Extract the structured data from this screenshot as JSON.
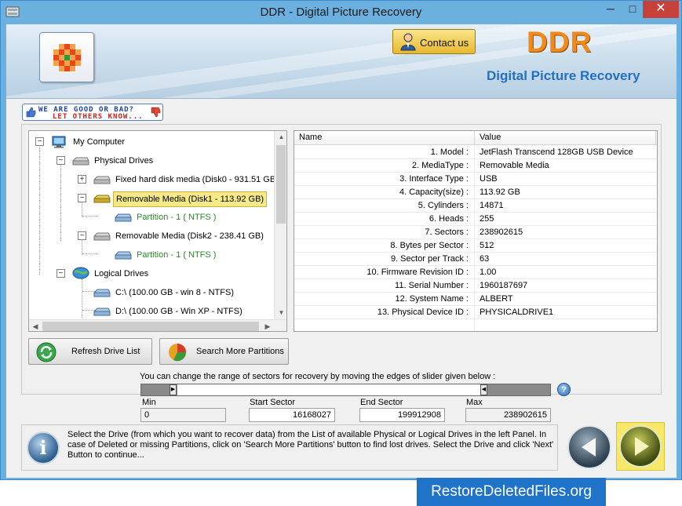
{
  "window": {
    "title": "DDR - Digital Picture Recovery",
    "controls": {
      "minimize": "─",
      "maximize": "□",
      "close": "✕"
    }
  },
  "header": {
    "contact_label": "Contact us",
    "brand": "DDR",
    "subtitle": "Digital Picture Recovery"
  },
  "feedback": {
    "line1": "WE ARE GOOD OR BAD?",
    "line2": "LET OTHERS KNOW..."
  },
  "tree": {
    "root": "My Computer",
    "physical_drives": "Physical Drives",
    "disk0": "Fixed hard disk media (Disk0 - 931.51 GB)",
    "disk1": "Removable Media (Disk1 - 113.92 GB)",
    "disk1_partition": "Partition - 1 ( NTFS )",
    "disk2": "Removable Media (Disk2 - 238.41 GB)",
    "disk2_partition": "Partition - 1 ( NTFS )",
    "logical_drives": "Logical Drives",
    "drive_c": "C:\\ (100.00 GB - win 8 - NTFS)",
    "drive_d": "D:\\ (100.00 GB - Win XP - NTFS)"
  },
  "table": {
    "columns": [
      "Name",
      "Value"
    ],
    "rows": [
      {
        "name": "1. Model :",
        "value": "JetFlash Transcend 128GB USB Device"
      },
      {
        "name": "2. MediaType :",
        "value": "Removable Media"
      },
      {
        "name": "3. Interface Type :",
        "value": "USB"
      },
      {
        "name": "4. Capacity(size) :",
        "value": "113.92 GB"
      },
      {
        "name": "5. Cylinders :",
        "value": "14871"
      },
      {
        "name": "6. Heads :",
        "value": "255"
      },
      {
        "name": "7. Sectors :",
        "value": "238902615"
      },
      {
        "name": "8. Bytes per Sector :",
        "value": "512"
      },
      {
        "name": "9. Sector per Track :",
        "value": "63"
      },
      {
        "name": "10. Firmware Revision ID :",
        "value": "1.00"
      },
      {
        "name": "11. Serial Number :",
        "value": "1960187697"
      },
      {
        "name": "12. System Name :",
        "value": "ALBERT"
      },
      {
        "name": "13. Physical Device ID :",
        "value": "PHYSICALDRIVE1"
      }
    ]
  },
  "buttons": {
    "refresh": "Refresh Drive List",
    "search": "Search More Partitions"
  },
  "sectors": {
    "instruction": "You can change the range of sectors for recovery by moving the edges of slider given below :",
    "min_label": "Min",
    "min_value": "0",
    "start_label": "Start Sector",
    "start_value": "16168027",
    "end_label": "End Sector",
    "end_value": "199912908",
    "max_label": "Max",
    "max_value": "238902615",
    "help": "?"
  },
  "info": {
    "icon": "i",
    "text": "Select the Drive (from which you want to recover data) from the List of available Physical or Logical Drives in the left Panel. In case of Deleted or missing Partitions, click on 'Search More Partitions' button to find lost drives. Select the Drive and click 'Next' Button to continue..."
  },
  "footer": {
    "site": "RestoreDeletedFiles.org"
  },
  "colors": {
    "frame": "#6cb0e0",
    "brand_orange": "#f08a1c",
    "subtitle_blue": "#2370c2",
    "selection": "#f6e987",
    "partition_green": "#2a8a2a",
    "footer_blue": "#1f73c9"
  }
}
